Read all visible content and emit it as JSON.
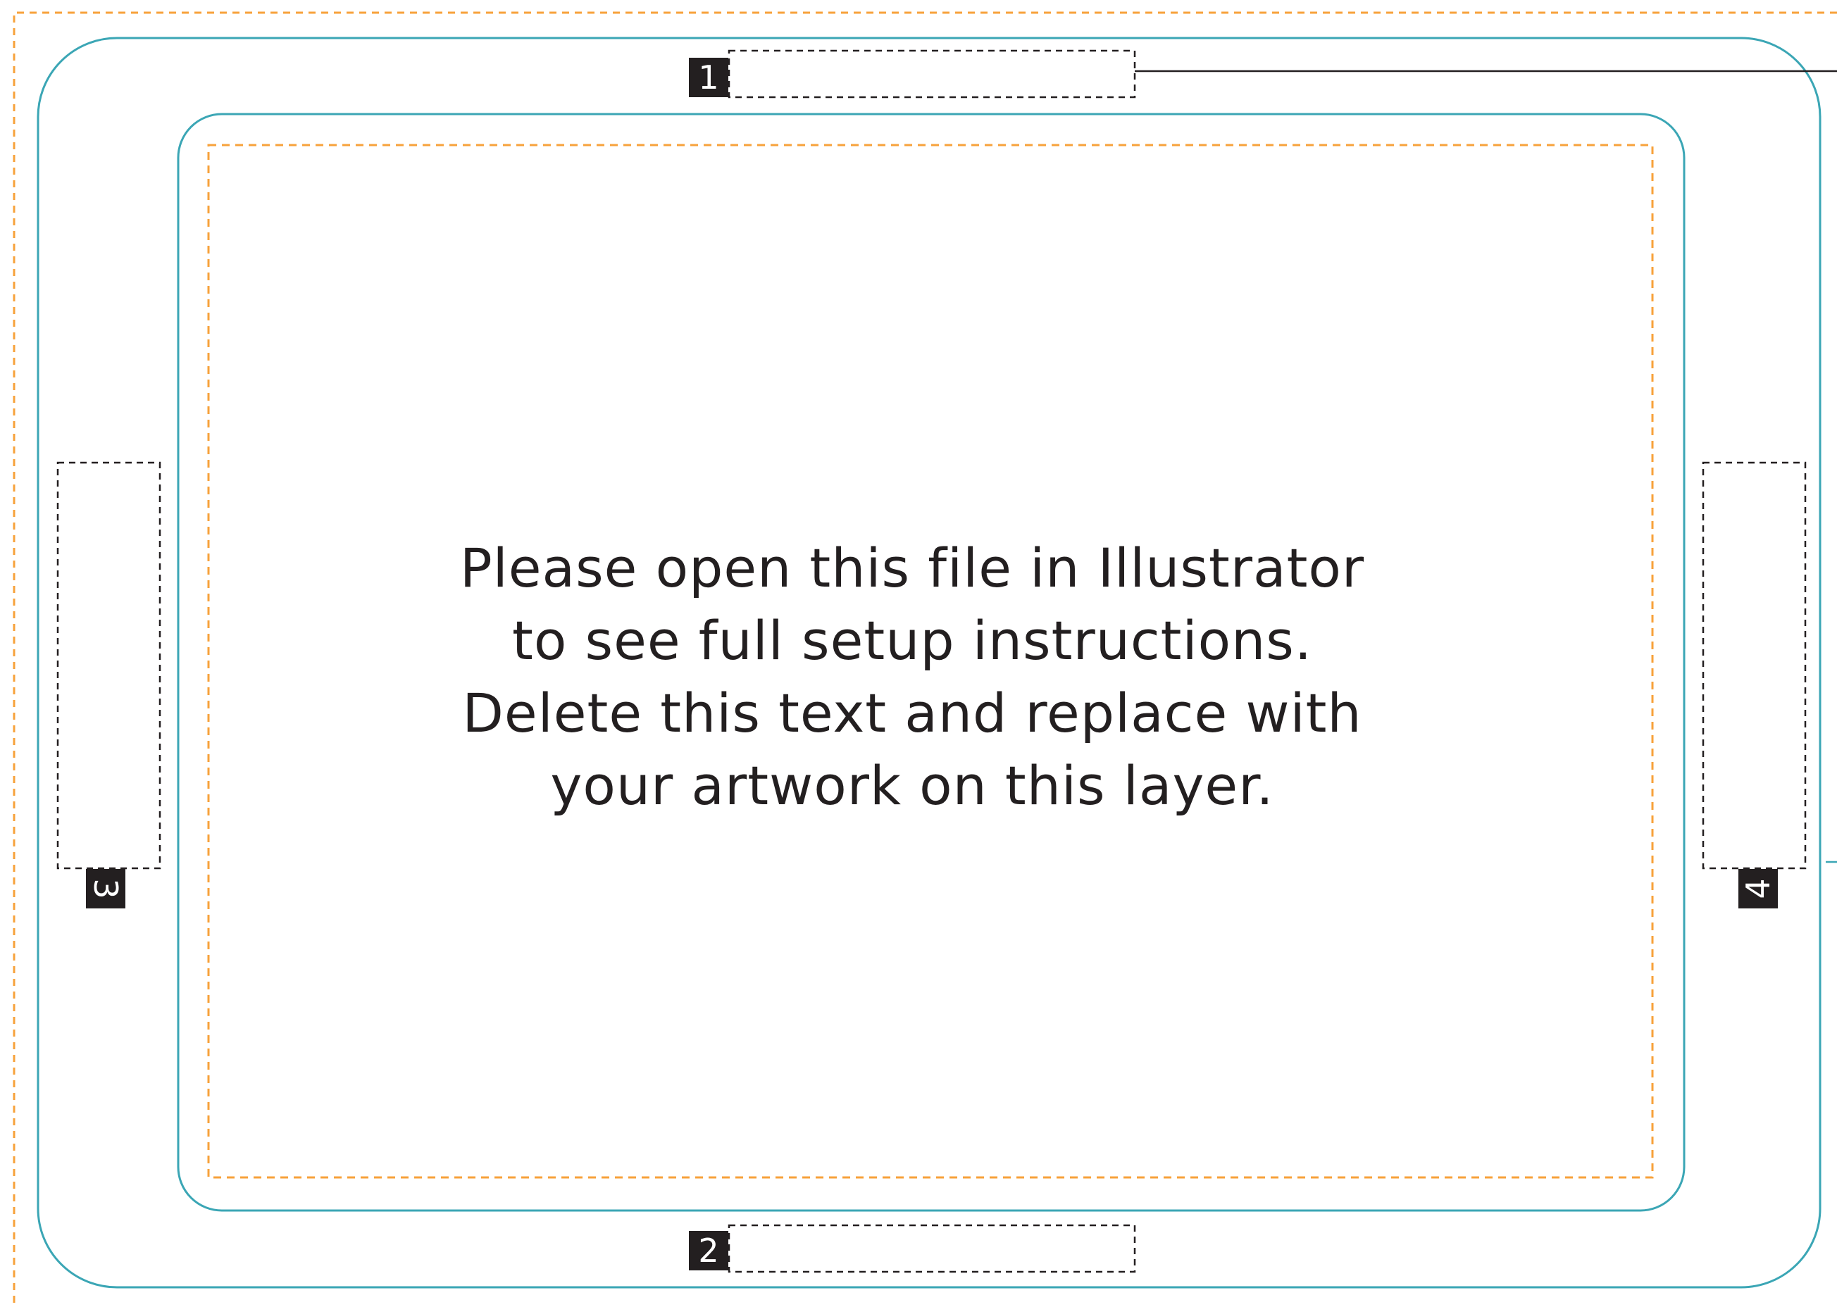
{
  "document": {
    "instruction_lines": [
      "Please open this file in Illustrator",
      "to see full setup instructions.",
      "Delete this text and replace with",
      "your artwork on this layer."
    ]
  },
  "markers": {
    "marker_1": "1",
    "marker_2": "2",
    "marker_3": "3",
    "marker_4": "4"
  },
  "colors": {
    "bleed_guide": "#F7A23B",
    "cut_line": "#3BA6B5",
    "placeholder_border": "#231F20",
    "text": "#231F20"
  }
}
